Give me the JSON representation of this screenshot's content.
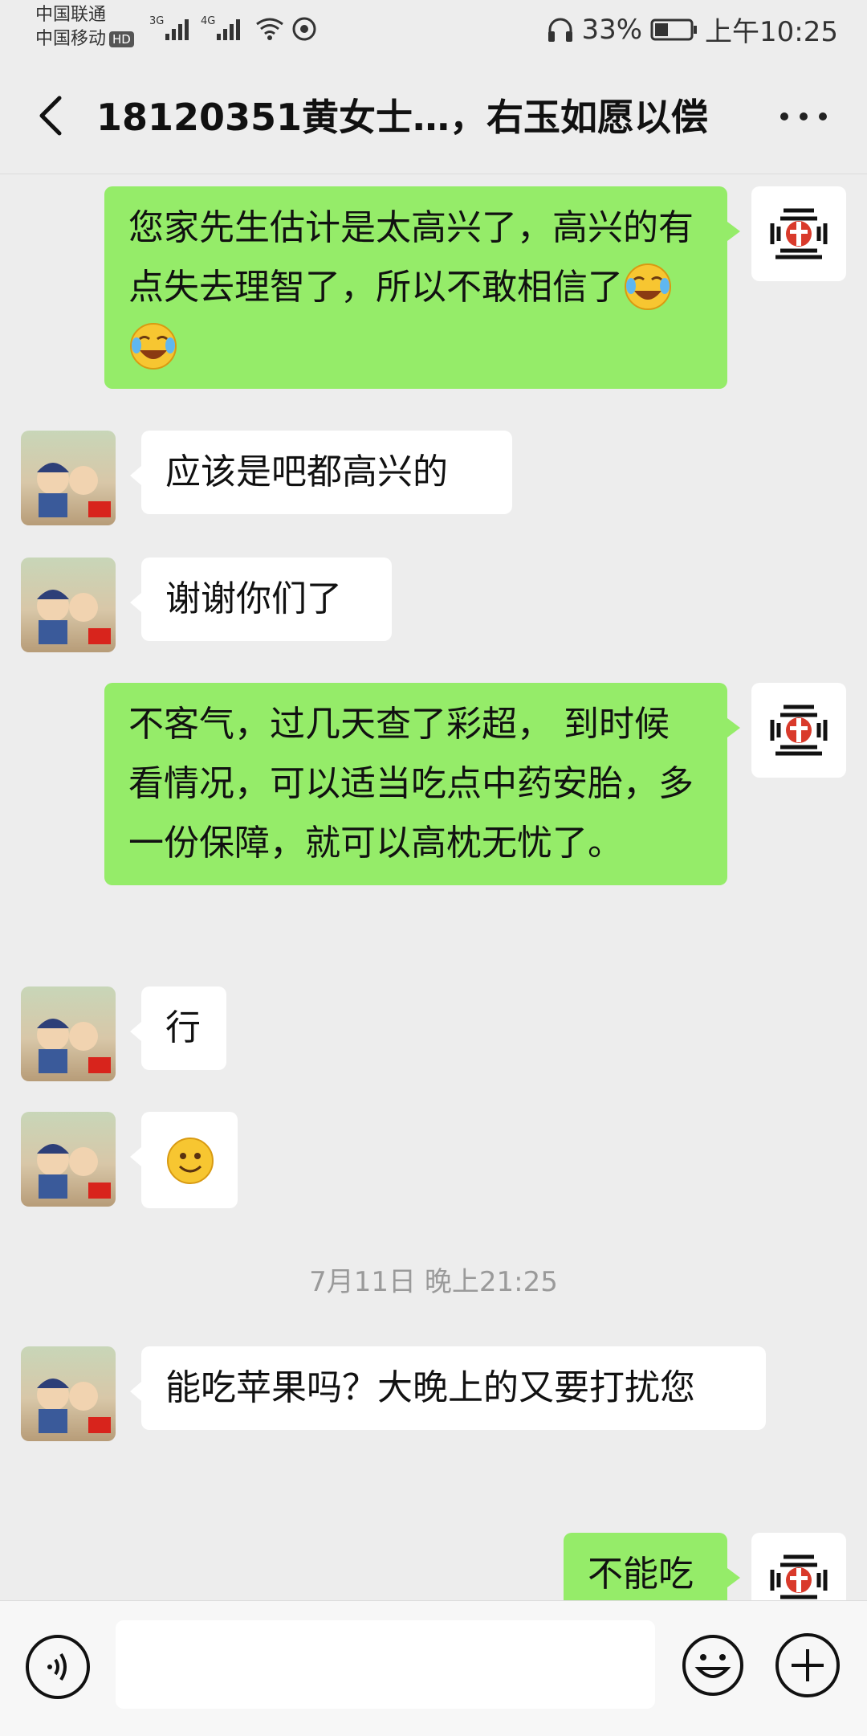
{
  "status_bar": {
    "carrier1": "中国联通",
    "carrier2": "中国移动",
    "hd": "HD",
    "net1": "3G",
    "net2": "4G",
    "battery": "33%",
    "time": "上午10:25"
  },
  "header": {
    "title": "18120351黄女士…，右玉如愿以偿"
  },
  "messages": [
    {
      "sender": "me",
      "text": "您家先生估计是太高兴了，高兴的有点失去理智了，所以不敢相信了",
      "emojis": [
        "cry-laugh",
        "cry-laugh"
      ]
    },
    {
      "sender": "them",
      "text": "应该是吧都高兴的"
    },
    {
      "sender": "them",
      "text": "谢谢你们了"
    },
    {
      "sender": "me",
      "text": "不客气，过几天查了彩超， 到时候看情况，可以适当吃点中药安胎，多一份保障，就可以高枕无忧了。"
    },
    {
      "sender": "them",
      "text": "行"
    },
    {
      "sender": "them",
      "text": "",
      "emojis": [
        "smile"
      ]
    },
    {
      "timestamp": "7月11日 晚上21:25"
    },
    {
      "sender": "them",
      "text": "能吃苹果吗？大晚上的又要打扰您"
    },
    {
      "sender": "me",
      "text": "不能吃"
    }
  ],
  "colors": {
    "my_bubble": "#95ec69",
    "their_bubble": "#ffffff",
    "background": "#ededed"
  },
  "icons": [
    "back-icon",
    "more-icon",
    "voice-icon",
    "emoji-icon",
    "plus-icon"
  ]
}
